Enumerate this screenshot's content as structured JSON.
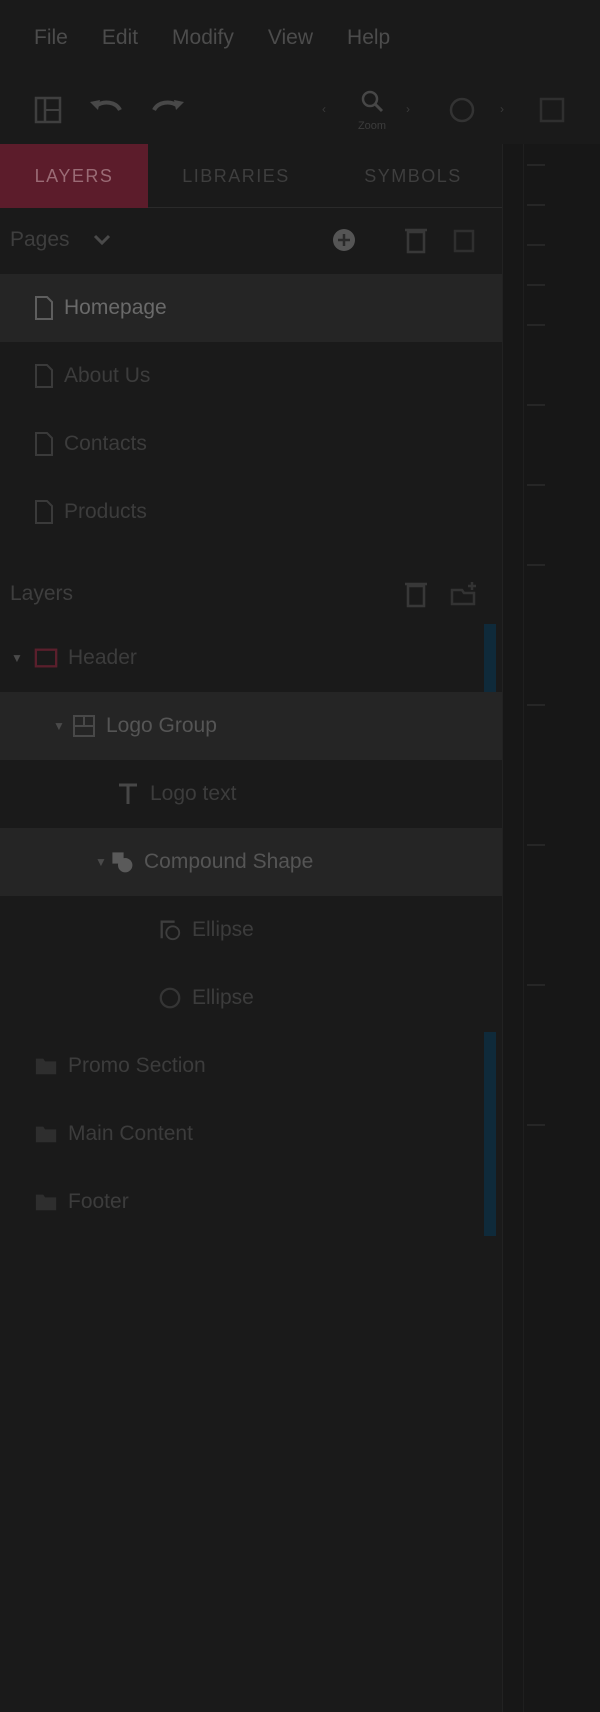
{
  "menu": {
    "items": [
      "File",
      "Edit",
      "Modify",
      "View",
      "Help"
    ]
  },
  "toolbar": {
    "zoom_label": "Zoom"
  },
  "tabs": [
    {
      "label": "LAYERS",
      "active": true
    },
    {
      "label": "LIBRARIES",
      "active": false
    },
    {
      "label": "SYMBOLS",
      "active": false
    }
  ],
  "pages": {
    "title": "Pages",
    "items": [
      {
        "label": "Homepage",
        "selected": true
      },
      {
        "label": "About Us",
        "selected": false
      },
      {
        "label": "Contacts",
        "selected": false
      },
      {
        "label": "Products",
        "selected": false
      }
    ]
  },
  "layers": {
    "title": "Layers",
    "items": [
      {
        "label": "Header",
        "icon": "artboard-icon",
        "expanded": true,
        "selected": false
      },
      {
        "label": "Logo Group",
        "icon": "group-icon",
        "expanded": true,
        "selected": true
      },
      {
        "label": "Logo text",
        "icon": "text-icon",
        "selected": false
      },
      {
        "label": "Compound Shape",
        "icon": "compound-shape-icon",
        "expanded": true,
        "selected": true
      },
      {
        "label": "Ellipse",
        "icon": "path-icon",
        "selected": false
      },
      {
        "label": "Ellipse",
        "icon": "ellipse-icon",
        "selected": false
      },
      {
        "label": "Promo Section",
        "icon": "folder-icon",
        "selected": false
      },
      {
        "label": "Main Content",
        "icon": "folder-icon",
        "selected": false
      },
      {
        "label": "Footer",
        "icon": "folder-icon",
        "selected": false
      }
    ]
  },
  "colors": {
    "background": "#1a1a1a",
    "accent": "#5c1c2b",
    "artboard_icon": "#5a1f2c",
    "indicator": "#0f2a3a"
  }
}
